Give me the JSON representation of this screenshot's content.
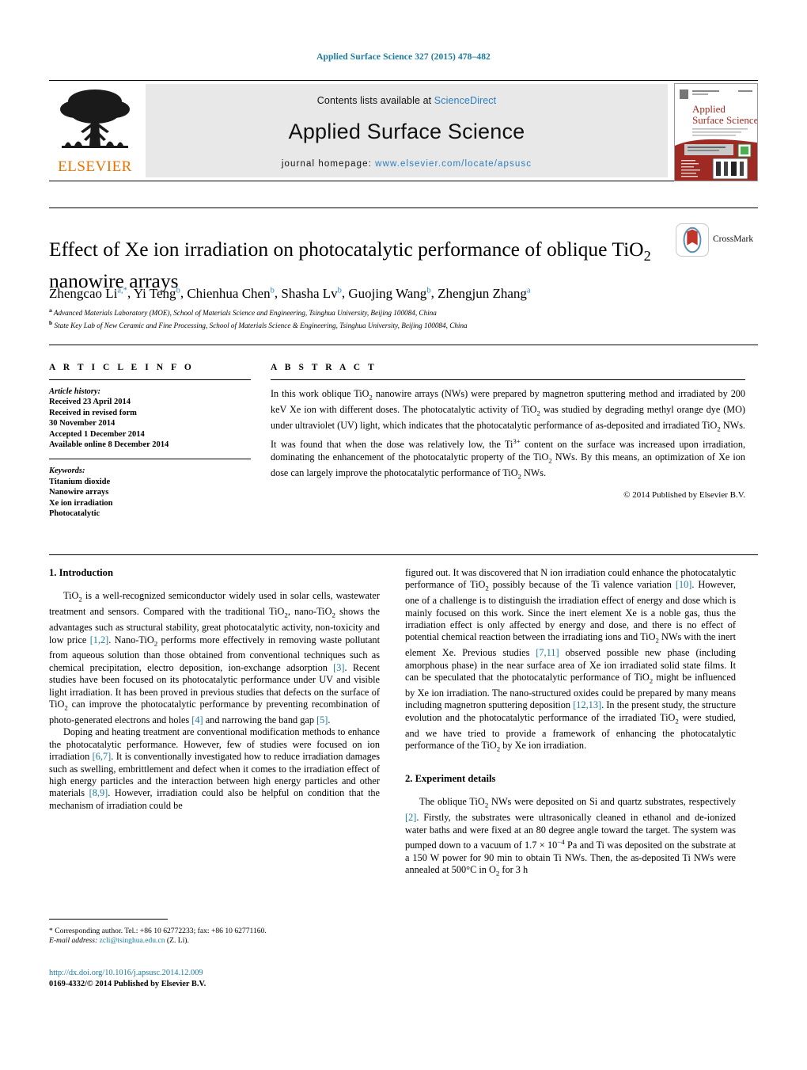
{
  "running_head": "Applied Surface Science 327 (2015) 478–482",
  "banner": {
    "publisher_name": "ELSEVIER",
    "publisher_logo_icon": "elsevier-tree-icon",
    "contents_prefix": "Contents lists available at",
    "sciencedirect_label": "ScienceDirect",
    "journal_name": "Applied Surface Science",
    "homepage_prefix": "journal homepage:",
    "homepage_url": "www.elsevier.com/locate/apsusc",
    "cover_title_line1": "Applied",
    "cover_title_line2": "Surface Science",
    "cover_color": "#9e2a23"
  },
  "article": {
    "title": "Effect of Xe ion irradiation on photocatalytic performance of oblique TiO2 nanowire arrays",
    "title_part1": "Effect of Xe ion irradiation on photocatalytic performance of oblique TiO",
    "title_sub": "2",
    "title_part2": " nanowire arrays",
    "crossmark_label": "CrossMark",
    "crossmark_icon": "crossmark-icon",
    "authors_raw": "Zhengcao Li a,*, Yi Teng b, Chienhua Chen b, Shasha Lv b, Guojing Wang b, Zhengjun Zhang a",
    "authors": [
      {
        "name": "Zhengcao Li",
        "marks": "a,*"
      },
      {
        "name": "Yi Teng",
        "marks": "b"
      },
      {
        "name": "Chienhua Chen",
        "marks": "b"
      },
      {
        "name": "Shasha Lv",
        "marks": "b"
      },
      {
        "name": "Guojing Wang",
        "marks": "b"
      },
      {
        "name": "Zhengjun Zhang",
        "marks": "a"
      }
    ],
    "affiliations": [
      {
        "mark": "a",
        "text": "Advanced Materials Laboratory (MOE), School of Materials Science and Engineering, Tsinghua University, Beijing 100084, China"
      },
      {
        "mark": "b",
        "text": "State Key Lab of New Ceramic and Fine Processing, School of Materials Science & Engineering, Tsinghua University, Beijing 100084, China"
      }
    ]
  },
  "article_info": {
    "heading": "A R T I C L E   I N F O",
    "history_label": "Article history:",
    "history": [
      "Received 23 April 2014",
      "Received in revised form",
      "30 November 2014",
      "Accepted 1 December 2014",
      "Available online 8 December 2014"
    ],
    "keywords_label": "Keywords:",
    "keywords": [
      "Titanium dioxide",
      "Nanowire arrays",
      "Xe ion irradiation",
      "Photocatalytic"
    ]
  },
  "abstract": {
    "heading": "A B S T R A C T",
    "p1a": "In this work oblique TiO",
    "p1b": "2",
    "p1c": " nanowire arrays (NWs) were prepared by magnetron sputtering method and irradiated by 200 keV Xe ion with different doses. The photocatalytic activity of TiO",
    "p1d": "2",
    "p1e": " was studied by degrading methyl orange dye (MO) under ultraviolet (UV) light, which indicates that the photocatalytic performance of as-deposited and irradiated TiO",
    "p1f": "2",
    "p1g": " NWs. It was found that when the dose was relatively low, the Ti",
    "p1h": "3+",
    "p1i": " content on the surface was increased upon irradiation, dominating the enhancement of the photocatalytic property of the TiO",
    "p1j": "2",
    "p1k": " NWs. By this means, an optimization of Xe ion dose can largely improve the photocatalytic performance of TiO",
    "p1l": "2",
    "p1m": " NWs.",
    "copyright": "© 2014 Published by Elsevier B.V."
  },
  "sections": {
    "intro_heading": "1.  Introduction",
    "experiment_heading": "2.  Experiment details"
  },
  "body": {
    "left_p1_a": "TiO",
    "left_p1_sub1": "2",
    "left_p1_b": " is a well-recognized semiconductor widely used in solar cells, wastewater treatment and sensors. Compared with the traditional TiO",
    "left_p1_sub2": "2",
    "left_p1_c": ", nano-TiO",
    "left_p1_sub3": "2",
    "left_p1_d": " shows the advantages such as structural stability, great photocatalytic activity, non-toxicity and low price ",
    "left_p1_cite1": "[1,2]",
    "left_p1_e": ". Nano-TiO",
    "left_p1_sub4": "2",
    "left_p1_f": " performs more effectively in removing waste pollutant from aqueous solution than those obtained from conventional techniques such as chemical precipitation, electro deposition, ion-exchange adsorption ",
    "left_p1_cite2": "[3]",
    "left_p1_g": ". Recent studies have been focused on its photocatalytic performance under UV and visible light irradiation. It has been proved in previous studies that defects on the surface of TiO",
    "left_p1_sub5": "2",
    "left_p1_h": " can improve the photocatalytic performance by preventing recombination of photo-generated electrons and holes ",
    "left_p1_cite3": "[4]",
    "left_p1_i": " and narrowing the band gap ",
    "left_p1_cite4": "[5]",
    "left_p1_j": ".",
    "left_p2_a": "Doping and heating treatment are conventional modification methods to enhance the photocatalytic performance. However, few of studies were focused on ion irradiation ",
    "left_p2_cite1": "[6,7]",
    "left_p2_b": ". It is conventionally investigated how to reduce irradiation damages such as swelling, embrittlement and defect when it comes to the irradiation effect of high energy particles and the interaction between high energy particles and other materials ",
    "left_p2_cite2": "[8,9]",
    "left_p2_c": ". However, irradiation could also be helpful on condition that the mechanism of irradiation could be",
    "right_p1_a": "figured out. It was discovered that N ion irradiation could enhance the photocatalytic performance of TiO",
    "right_p1_sub1": "2",
    "right_p1_b": " possibly because of the Ti valence variation ",
    "right_p1_cite1": "[10]",
    "right_p1_c": ". However, one of a challenge is to distinguish the irradiation effect of energy and dose which is mainly focused on this work. Since the inert element Xe is a noble gas, thus the irradiation effect is only affected by energy and dose, and there is no effect of potential chemical reaction between the irradiating ions and TiO",
    "right_p1_sub2": "2",
    "right_p1_d": " NWs with the inert element Xe. Previous studies ",
    "right_p1_cite2": "[7,11]",
    "right_p1_e": " observed possible new phase (including amorphous phase) in the near surface area of Xe ion irradiated solid state films. It can be speculated that the photocatalytic performance of TiO",
    "right_p1_sub3": "2",
    "right_p1_f": " might be influenced by Xe ion irradiation. The nano-structured oxides could be prepared by many means including magnetron sputtering deposition ",
    "right_p1_cite3": "[12,13]",
    "right_p1_g": ". In the present study, the structure evolution and the photocatalytic performance of the irradiated TiO",
    "right_p1_sub4": "2",
    "right_p1_h": " were studied, and we have tried to provide a framework of enhancing the photocatalytic performance of the TiO",
    "right_p1_sub5": "2",
    "right_p1_i": " by Xe ion irradiation.",
    "right_p2_a": "The oblique TiO",
    "right_p2_sub1": "2",
    "right_p2_b": " NWs were deposited on Si and quartz substrates, respectively ",
    "right_p2_cite1": "[2]",
    "right_p2_c": ". Firstly, the substrates were ultrasonically cleaned in ethanol and de-ionized water baths and were fixed at an 80 degree angle toward the target. The system was pumped down to a vacuum of 1.7 × 10",
    "right_p2_sup1": "−4",
    "right_p2_d": " Pa and Ti was deposited on the substrate at a 150 W power for 90 min to obtain Ti NWs. Then, the as-deposited Ti NWs were annealed at 500°C in O",
    "right_p2_sub2": "2",
    "right_p2_e": " for 3 h"
  },
  "footer": {
    "corresponding_mark": "*",
    "corresponding": "Corresponding author. Tel.: +86 10 62772233; fax: +86 10 62771160.",
    "email_label": "E-mail address:",
    "email": "zcli@tsinghua.edu.cn",
    "email_owner": "(Z. Li).",
    "doi": "http://dx.doi.org/10.1016/j.apsusc.2014.12.009",
    "issn_line": "0169-4332/© 2014 Published by Elsevier B.V."
  }
}
